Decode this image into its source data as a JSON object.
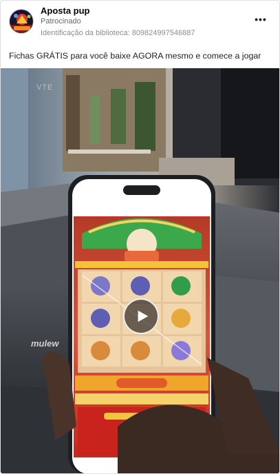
{
  "post": {
    "page_name": "Aposta pup",
    "sponsored_label": "Patrocinado",
    "library_id": "Identificação da biblioteca: 809824997546887",
    "text": "Fichas GRÁTIS para você baixe AGORA mesmo e comece a jogar"
  },
  "icons": {
    "more": "more-options-icon",
    "play": "play-icon",
    "avatar": "game-logo-avatar"
  },
  "colors": {
    "accent": "#1877f2",
    "slot_red": "#d42a1e",
    "slot_gold": "#f2c230"
  }
}
